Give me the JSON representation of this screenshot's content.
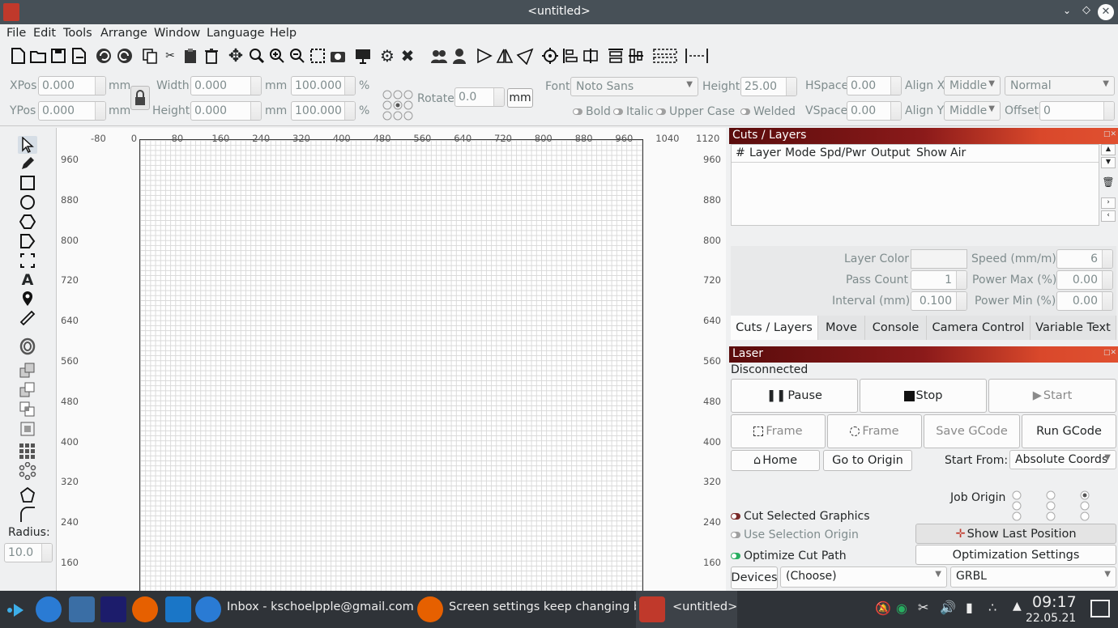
{
  "window": {
    "title": "<untitled>"
  },
  "menu": [
    "File",
    "Edit",
    "Tools",
    "Arrange",
    "Window",
    "Language",
    "Help"
  ],
  "props": {
    "xpos_label": "XPos",
    "xpos": "0.000",
    "ypos_label": "YPos",
    "ypos": "0.000",
    "unit_mm": "mm",
    "width_label": "Width",
    "width": "0.000",
    "height_label": "Height",
    "height": "0.000",
    "width_pct": "100.000",
    "height_pct": "100.000",
    "pct": "%",
    "rotate_label": "Rotate",
    "rotate": "0.0",
    "mm_button": "mm",
    "font_label": "Font",
    "font": "Noto Sans",
    "font_height_label": "Height",
    "font_height": "25.00",
    "bold": "Bold",
    "italic": "Italic",
    "upper": "Upper Case",
    "welded": "Welded",
    "hspace_label": "HSpace",
    "hspace": "0.00",
    "vspace_label": "VSpace",
    "vspace": "0.00",
    "alignx_label": "Align X",
    "alignx": "Middle",
    "aligny_label": "Align Y",
    "aligny": "Middle",
    "style": "Normal",
    "offset_label": "Offset",
    "offset": "0"
  },
  "left": {
    "radius_label": "Radius:",
    "radius": "10.0"
  },
  "ruler": {
    "top": [
      "-80",
      "0",
      "80",
      "160",
      "240",
      "320",
      "400",
      "480",
      "560",
      "640",
      "720",
      "800",
      "880",
      "960",
      "1040",
      "1120"
    ],
    "left": [
      "960",
      "880",
      "800",
      "720",
      "640",
      "560",
      "480",
      "400",
      "320",
      "240",
      "160"
    ]
  },
  "cuts": {
    "title": "Cuts / Layers",
    "columns": [
      "#",
      "Layer",
      "Mode",
      "Spd/Pwr",
      "Output",
      "Show",
      "Air"
    ],
    "layer_color_label": "Layer Color",
    "speed_label": "Speed (mm/m)",
    "speed": "6",
    "pass_label": "Pass Count",
    "pass": "1",
    "pmax_label": "Power Max (%)",
    "pmax": "0.00",
    "interval_label": "Interval (mm)",
    "interval": "0.100",
    "pmin_label": "Power Min (%)",
    "pmin": "0.00"
  },
  "tabs": [
    "Cuts / Layers",
    "Move",
    "Console",
    "Camera Control",
    "Variable Text"
  ],
  "laser": {
    "title": "Laser",
    "status": "Disconnected",
    "pause": "Pause",
    "stop": "Stop",
    "start": "Start",
    "frame1": "Frame",
    "frame2": "Frame",
    "save_gcode": "Save GCode",
    "run_gcode": "Run GCode",
    "home": "Home",
    "go_origin": "Go to Origin",
    "start_from_label": "Start From:",
    "start_from": "Absolute Coords",
    "job_origin_label": "Job Origin",
    "cut_selected": "Cut Selected Graphics",
    "use_selection": "Use Selection Origin",
    "optimize": "Optimize Cut Path",
    "show_last": "Show Last Position",
    "opt_settings": "Optimization Settings",
    "devices": "Devices",
    "choose": "(Choose)",
    "grbl": "GRBL"
  },
  "taskbar": {
    "t1": "Inbox - kschoelpple@gmail.com ...",
    "t2": "Screen settings keep changing b...",
    "t3": "<untitled>",
    "time": "09:17",
    "date": "22.05.21"
  },
  "colors": {
    "accent": "#c0392b",
    "titlebar": "#475057",
    "taskbar": "#2f3338"
  }
}
